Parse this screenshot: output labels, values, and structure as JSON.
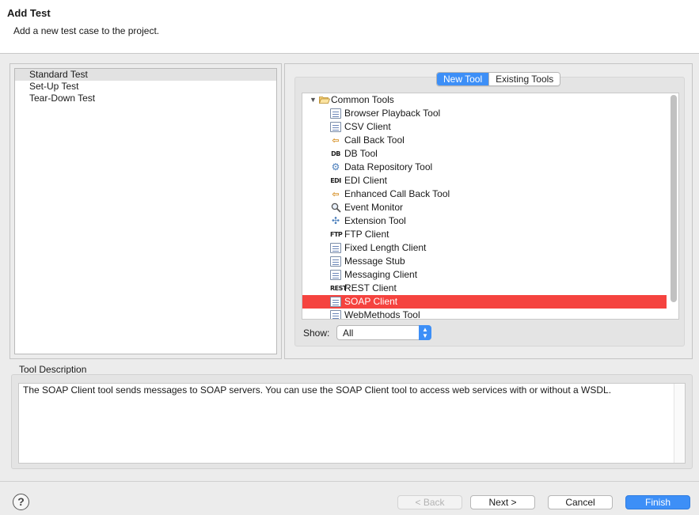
{
  "header": {
    "title": "Add Test",
    "subtitle": "Add a new test case to the project."
  },
  "tests": [
    {
      "label": "Standard Test",
      "selected": true
    },
    {
      "label": "Set-Up Test",
      "selected": false
    },
    {
      "label": "Tear-Down Test",
      "selected": false
    }
  ],
  "tabs": {
    "new_tool": "New Tool",
    "existing_tools": "Existing Tools"
  },
  "tree": {
    "root_label": "Common Tools",
    "items": [
      {
        "label": "Browser Playback Tool",
        "icon": "browser-playback-icon"
      },
      {
        "label": "CSV Client",
        "icon": "csv-client-icon"
      },
      {
        "label": "Call Back Tool",
        "icon": "call-back-icon"
      },
      {
        "label": "DB Tool",
        "icon": "db-icon"
      },
      {
        "label": "Data Repository Tool",
        "icon": "data-repository-icon"
      },
      {
        "label": "EDI Client",
        "icon": "edi-icon"
      },
      {
        "label": "Enhanced Call Back Tool",
        "icon": "enhanced-call-back-icon"
      },
      {
        "label": "Event Monitor",
        "icon": "magnifier-icon"
      },
      {
        "label": "Extension Tool",
        "icon": "extension-icon"
      },
      {
        "label": "FTP Client",
        "icon": "ftp-icon"
      },
      {
        "label": "Fixed Length Client",
        "icon": "fixed-length-icon"
      },
      {
        "label": "Message Stub",
        "icon": "message-stub-icon"
      },
      {
        "label": "Messaging Client",
        "icon": "messaging-client-icon"
      },
      {
        "label": "REST Client",
        "icon": "rest-icon"
      },
      {
        "label": "SOAP Client",
        "icon": "soap-icon",
        "selected": true
      },
      {
        "label": "WebMethods Tool",
        "icon": "webmethods-icon"
      }
    ]
  },
  "show": {
    "label": "Show:",
    "value": "All"
  },
  "description": {
    "label": "Tool Description",
    "text": "The SOAP Client tool sends messages to SOAP servers. You can use the SOAP Client tool to access web services with or without a WSDL."
  },
  "buttons": {
    "help": "?",
    "back": "< Back",
    "next": "Next >",
    "cancel": "Cancel",
    "finish": "Finish"
  },
  "colors": {
    "accent": "#3d8ff7",
    "selection": "#f5433f"
  }
}
